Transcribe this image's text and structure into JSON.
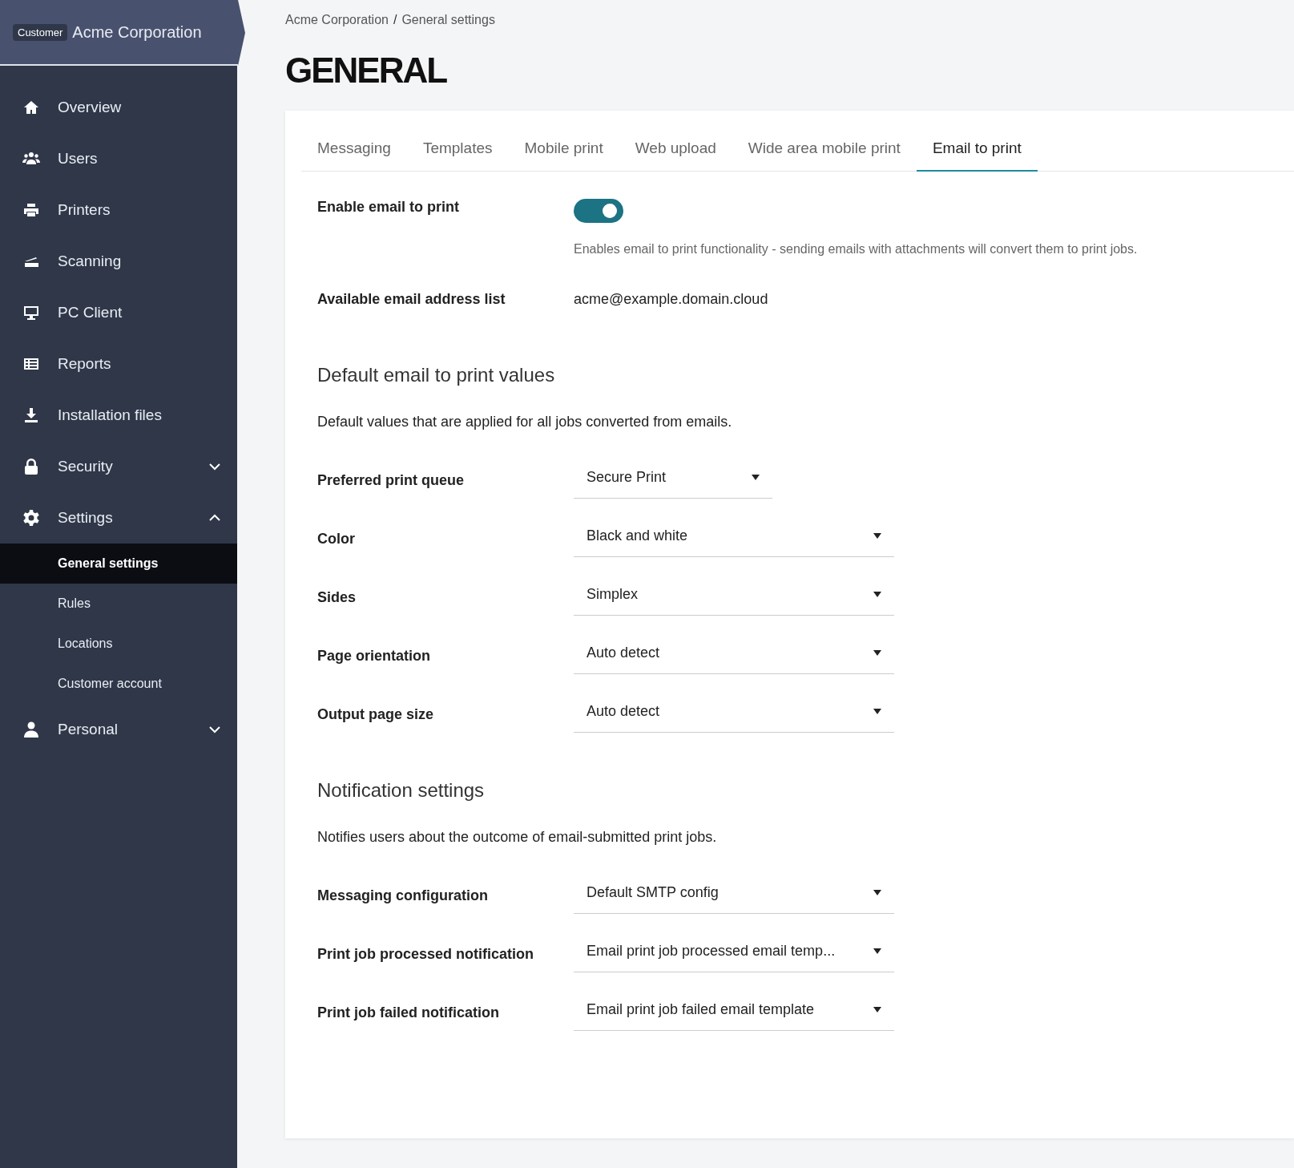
{
  "sidebar": {
    "badge": "Customer",
    "org_name": "Acme Corporation",
    "items": [
      {
        "label": "Overview"
      },
      {
        "label": "Users"
      },
      {
        "label": "Printers"
      },
      {
        "label": "Scanning"
      },
      {
        "label": "PC Client"
      },
      {
        "label": "Reports"
      },
      {
        "label": "Installation files"
      },
      {
        "label": "Security",
        "expanded": false
      },
      {
        "label": "Settings",
        "expanded": true,
        "children": [
          {
            "label": "General settings",
            "selected": true
          },
          {
            "label": "Rules",
            "selected": false
          },
          {
            "label": "Locations",
            "selected": false
          },
          {
            "label": "Customer account",
            "selected": false
          }
        ]
      },
      {
        "label": "Personal",
        "expanded": false
      }
    ]
  },
  "breadcrumb": [
    "Acme Corporation",
    "General settings"
  ],
  "breadcrumb_separator": "/",
  "page_title": "GENERAL",
  "tabs": [
    {
      "label": "Messaging",
      "selected": false
    },
    {
      "label": "Templates",
      "selected": false
    },
    {
      "label": "Mobile print",
      "selected": false
    },
    {
      "label": "Web upload",
      "selected": false
    },
    {
      "label": "Wide area mobile print",
      "selected": false
    },
    {
      "label": "Email to print",
      "selected": true
    }
  ],
  "sections": [
    {
      "rows": [
        {
          "kind": "toggle",
          "label": "Enable email to print",
          "on": true,
          "help": "Enables email to print functionality - sending emails with attachments will convert them to print jobs."
        },
        {
          "kind": "text",
          "label": "Available email address list",
          "value": "acme@example.domain.cloud"
        }
      ]
    },
    {
      "heading": "Default email to print values",
      "description": "Default values that are applied for all jobs converted from emails.",
      "rows": [
        {
          "kind": "select",
          "label": "Preferred print queue",
          "value": "Secure Print"
        },
        {
          "kind": "select",
          "label": "Color",
          "value": "Black and white"
        },
        {
          "kind": "select",
          "label": "Sides",
          "value": "Simplex"
        },
        {
          "kind": "select",
          "label": "Page orientation",
          "value": "Auto detect"
        },
        {
          "kind": "select",
          "label": "Output page size",
          "value": "Auto detect"
        }
      ]
    },
    {
      "heading": "Notification settings",
      "description": "Notifies users about the outcome of email-submitted print jobs.",
      "rows": [
        {
          "kind": "select",
          "label": "Messaging configuration",
          "value": "Default SMTP config"
        },
        {
          "kind": "select",
          "label": "Print job processed notification",
          "value": "Email print job processed email temp..."
        },
        {
          "kind": "select",
          "label": "Print job failed notification",
          "value": "Email print job failed email template"
        }
      ]
    }
  ]
}
